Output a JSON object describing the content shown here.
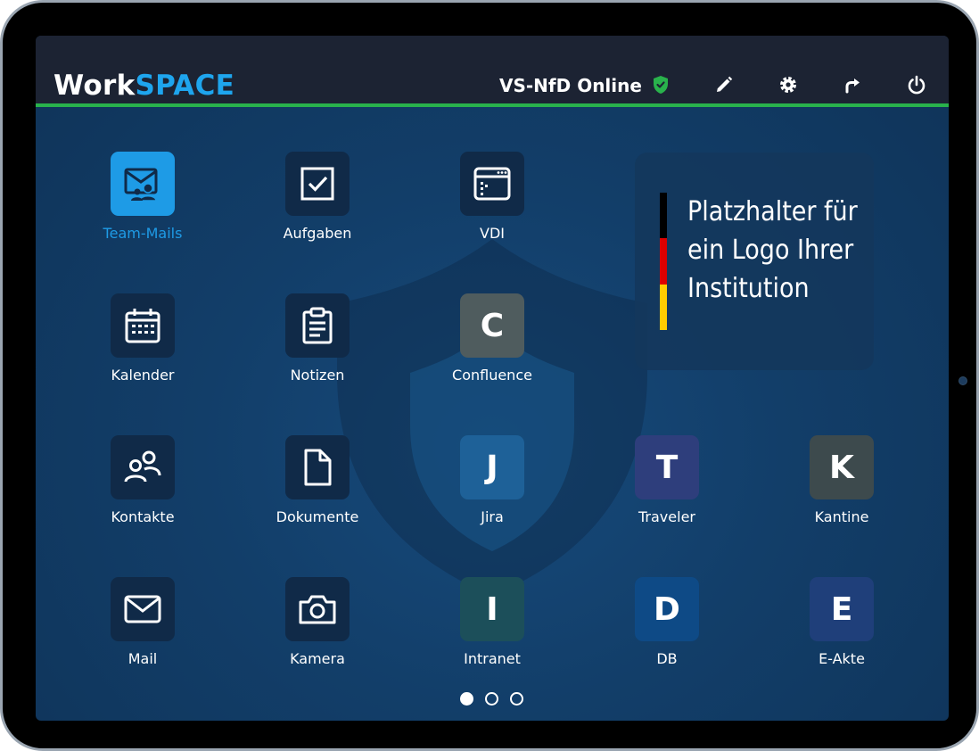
{
  "header": {
    "brand_part1": "Work",
    "brand_part2": "SPACE",
    "status": "VS-NfD Online",
    "icons": [
      "shield-check-icon",
      "pencil-icon",
      "gear-icon",
      "redo-icon",
      "power-icon"
    ],
    "colors": {
      "accent": "#1ea5ee",
      "status_green": "#29b24c",
      "header_bg": "#1c2333"
    }
  },
  "apps": {
    "team_mails": "Team-Mails",
    "aufgaben": "Aufgaben",
    "vdi": "VDI",
    "kalender": "Kalender",
    "notizen": "Notizen",
    "confluence": {
      "letter": "C",
      "label": "Confluence",
      "color": "#4f5c5e"
    },
    "kontakte": "Kontakte",
    "dokumente": "Dokumente",
    "jira": {
      "letter": "J",
      "label": "Jira",
      "color": "#1e6198"
    },
    "traveler": {
      "letter": "T",
      "label": "Traveler",
      "color": "#2e3e7c"
    },
    "kantine": {
      "letter": "K",
      "label": "Kantine",
      "color": "#3d4a4d"
    },
    "mail": "Mail",
    "kamera": "Kamera",
    "intranet": {
      "letter": "I",
      "label": "Intranet",
      "color": "#1c4f5a"
    },
    "db": {
      "letter": "D",
      "label": "DB",
      "color": "#0e4a86"
    },
    "eakte": {
      "letter": "E",
      "label": "E-Akte",
      "color": "#1f3f7a"
    }
  },
  "logo_placeholder": {
    "text": "Platzhalter für\nein Logo Ihrer\nInstitution",
    "flag_colors": [
      "#000000",
      "#dd0000",
      "#ffcc00"
    ]
  },
  "pagination": {
    "pages": 3,
    "current": 1
  }
}
